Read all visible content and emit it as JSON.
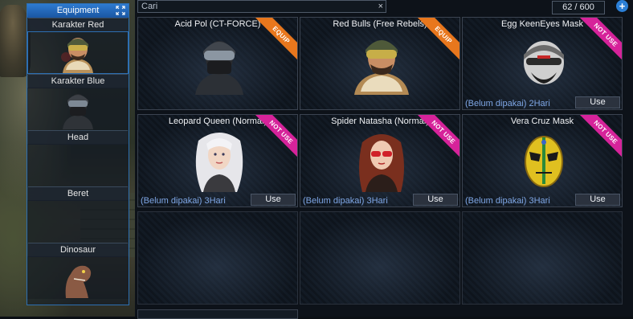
{
  "equipment_panel": {
    "title": "Equipment",
    "expand_icon": "expand-arrows-icon",
    "slots": [
      {
        "label": "Karakter Red"
      },
      {
        "label": "Karakter Blue"
      },
      {
        "label": "Head"
      },
      {
        "label": "Beret"
      },
      {
        "label": "Dinosaur"
      }
    ]
  },
  "search": {
    "value": "Cari",
    "clear_label": "×"
  },
  "counter": {
    "text": "62 / 600"
  },
  "add_button": {
    "label": "+"
  },
  "items": [
    {
      "title": "Acid Pol (CT-FORCE)",
      "badge": "EQUIP",
      "status": "",
      "action": ""
    },
    {
      "title": "Red Bulls (Free Rebels)",
      "badge": "EQUIP",
      "status": "",
      "action": ""
    },
    {
      "title": "Egg KeenEyes Mask",
      "badge": "NOT USE",
      "status": "(Belum dipakai) 2Hari",
      "action": "Use"
    },
    {
      "title": "Leopard Queen (Normal)",
      "badge": "NOT USE",
      "status": "(Belum dipakai) 3Hari",
      "action": "Use"
    },
    {
      "title": "Spider Natasha (Normal)",
      "badge": "NOT USE",
      "status": "(Belum dipakai) 3Hari",
      "action": "Use"
    },
    {
      "title": "Vera Cruz Mask",
      "badge": "NOT USE",
      "status": "(Belum dipakai) 3Hari",
      "action": "Use"
    }
  ],
  "colors": {
    "accent_blue": "#2d6fb2",
    "equip_badge": "#e8771d",
    "notuse_badge": "#d6239a",
    "status_text": "#7fa7e6"
  }
}
